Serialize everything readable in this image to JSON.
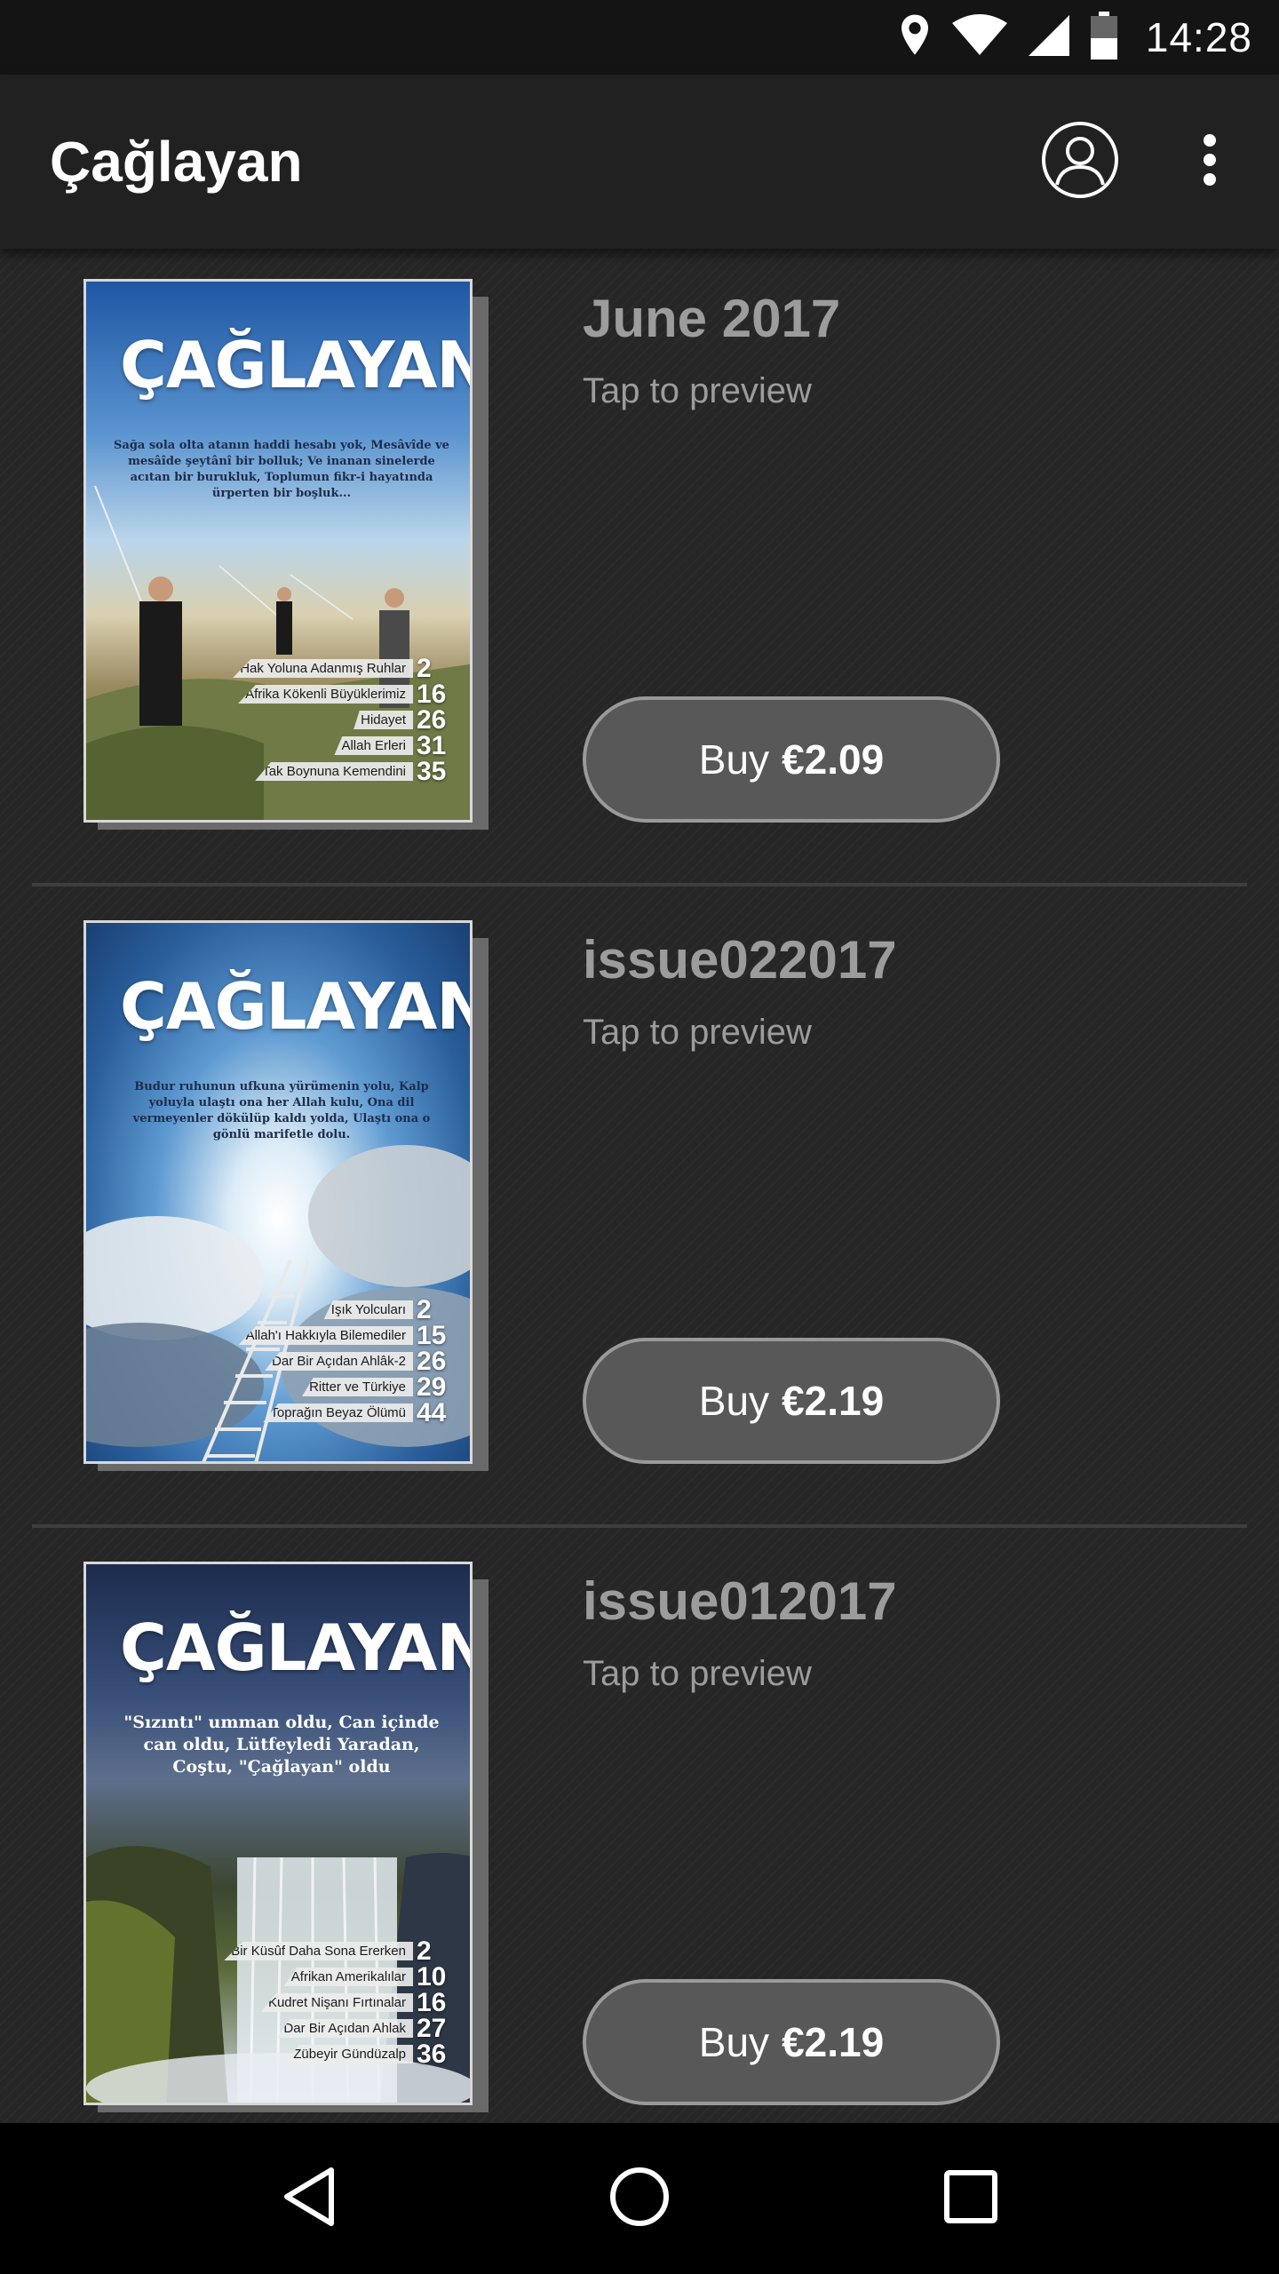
{
  "status_bar": {
    "time": "14:28",
    "icons": [
      "location-icon",
      "wifi-icon",
      "signal-icon",
      "battery-icon"
    ]
  },
  "app_bar": {
    "title": "Çağlayan",
    "account_icon": "account-circle-icon",
    "overflow_icon": "more-vert-icon"
  },
  "issues": [
    {
      "title": "June 2017",
      "subtitle": "Tap to preview",
      "buy_prefix": "Buy",
      "price": "€2.09",
      "cover": {
        "logo": "ÇAĞLAYAN",
        "poem": "Sağa sola olta atanın haddi hesabı yok, Mesâvîde ve mesâîde şeytânî bir bolluk; Ve inanan sinelerde acıtan bir burukluk, Toplumun fikr-i hayatında ürperten bir boşluk...",
        "toc": [
          {
            "label": "Hak Yoluna Adanmış Ruhlar",
            "page": "2"
          },
          {
            "label": "Afrika Kökenli Büyüklerimiz",
            "page": "16"
          },
          {
            "label": "Hidayet",
            "page": "26"
          },
          {
            "label": "Allah Erleri",
            "page": "31"
          },
          {
            "label": "Tak Boynuna Kemendini",
            "page": "35"
          }
        ]
      }
    },
    {
      "title": "issue022017",
      "subtitle": "Tap to preview",
      "buy_prefix": "Buy",
      "price": "€2.19",
      "cover": {
        "logo": "ÇAĞLAYAN",
        "poem": "Budur ruhunun ufkuna yürümenin yolu, Kalp yoluyla ulaştı ona her Allah kulu, Ona dil vermeyenler dökülüp kaldı yolda, Ulaştı ona o gönlü marifetle dolu.",
        "toc": [
          {
            "label": "Işık Yolcuları",
            "page": "2"
          },
          {
            "label": "Allah'ı Hakkıyla Bilemediler",
            "page": "15"
          },
          {
            "label": "Dar Bir Açıdan Ahlâk-2",
            "page": "26"
          },
          {
            "label": "Ritter ve Türkiye",
            "page": "29"
          },
          {
            "label": "Toprağın Beyaz Ölümü",
            "page": "44"
          }
        ]
      }
    },
    {
      "title": "issue012017",
      "subtitle": "Tap to preview",
      "buy_prefix": "Buy",
      "price": "€2.19",
      "cover": {
        "logo": "ÇAĞLAYAN",
        "poem": "\"Sızıntı\" umman oldu, Can içinde can oldu, Lütfeyledi Yaradan, Coştu, \"Çağlayan\" oldu",
        "toc": [
          {
            "label": "Bir Küsûf Daha Sona Ererken",
            "page": "2"
          },
          {
            "label": "Afrikan Amerikalılar",
            "page": "10"
          },
          {
            "label": "Kudret Nişanı Fırtınalar",
            "page": "16"
          },
          {
            "label": "Dar Bir Açıdan Ahlak",
            "page": "27"
          },
          {
            "label": "Zübeyir Gündüzalp",
            "page": "36"
          }
        ]
      }
    }
  ],
  "nav_bar": {
    "icons": [
      "back-triangle-icon",
      "home-circle-icon",
      "recents-square-icon"
    ]
  }
}
